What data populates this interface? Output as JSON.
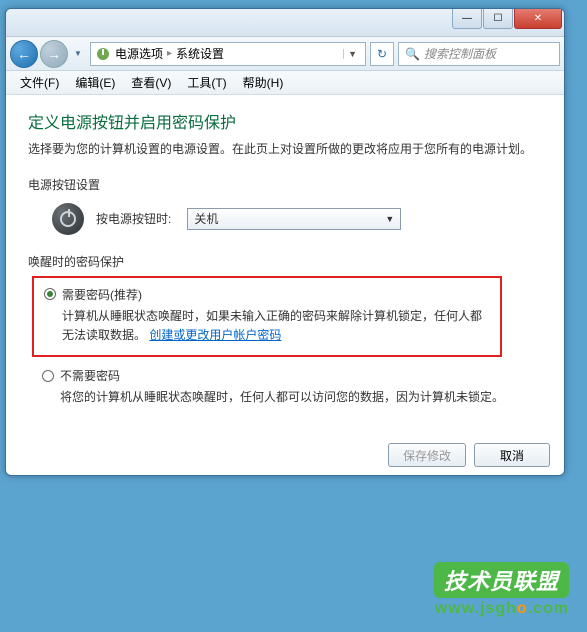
{
  "window_controls": {
    "min": "—",
    "max": "☐",
    "close": "✕"
  },
  "nav": {
    "back_glyph": "←",
    "fwd_glyph": "→",
    "dropdown_glyph": "▼",
    "refresh_glyph": "↻"
  },
  "breadcrumb": {
    "item1": "电源选项",
    "item2": "系统设置",
    "sep": "▸"
  },
  "search": {
    "placeholder": "搜索控制面板",
    "icon": "🔍"
  },
  "menubar": {
    "file": "文件(F)",
    "edit": "编辑(E)",
    "view": "查看(V)",
    "tools": "工具(T)",
    "help": "帮助(H)"
  },
  "page": {
    "title": "定义电源按钮并启用密码保护",
    "desc": "选择要为您的计算机设置的电源设置。在此页上对设置所做的更改将应用于您所有的电源计划。"
  },
  "power_button": {
    "section_label": "电源按钮设置",
    "label": "按电源按钮时:",
    "value": "关机"
  },
  "wake": {
    "section_label": "唤醒时的密码保护",
    "opt1": {
      "label": "需要密码(推荐)",
      "desc_prefix": "计算机从睡眠状态唤醒时，如果未输入正确的密码来解除计算机锁定，任何人都无法读取数据。",
      "link": "创建或更改用户帐户密码"
    },
    "opt2": {
      "label": "不需要密码",
      "desc": "将您的计算机从睡眠状态唤醒时，任何人都可以访问您的数据，因为计算机未锁定。"
    }
  },
  "buttons": {
    "save": "保存修改",
    "cancel": "取消"
  },
  "watermark": {
    "badge": "技术员联盟",
    "url_prefix": "www.jsgh",
    "url_o": "o",
    "url_suffix": ".com"
  }
}
